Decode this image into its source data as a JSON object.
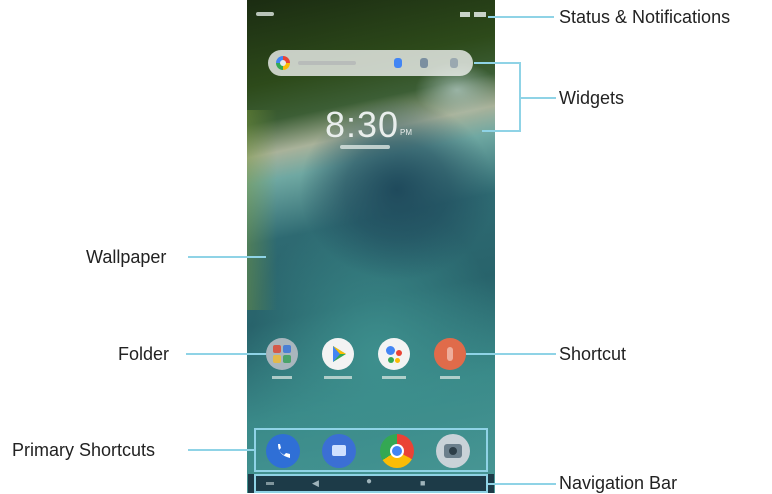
{
  "callouts": {
    "status": "Status & Notifications",
    "widgets": "Widgets",
    "wallpaper": "Wallpaper",
    "folder": "Folder",
    "shortcut": "Shortcut",
    "primary_shortcuts": "Primary Shortcuts",
    "navigation_bar": "Navigation Bar"
  },
  "phone": {
    "clock_time": "8:30",
    "clock_ampm": "PM",
    "apps": [
      {
        "icon": "folder-icon",
        "color": "#a9b6bd"
      },
      {
        "icon": "play-store-icon",
        "color": "#f3f3f3"
      },
      {
        "icon": "assistant-icon",
        "color": "#f3f3f3"
      },
      {
        "icon": "shortcut-icon",
        "color": "#e06b4a"
      }
    ],
    "dock": [
      {
        "icon": "phone-icon",
        "color": "#2f6fd6"
      },
      {
        "icon": "messages-icon",
        "color": "#3b6fd4"
      },
      {
        "icon": "chrome-icon",
        "color": "#e8b630"
      },
      {
        "icon": "camera-icon",
        "color": "#c9d2d8"
      }
    ]
  },
  "colors": {
    "callout_line": "#8fd3e6",
    "label_text": "#222222"
  }
}
